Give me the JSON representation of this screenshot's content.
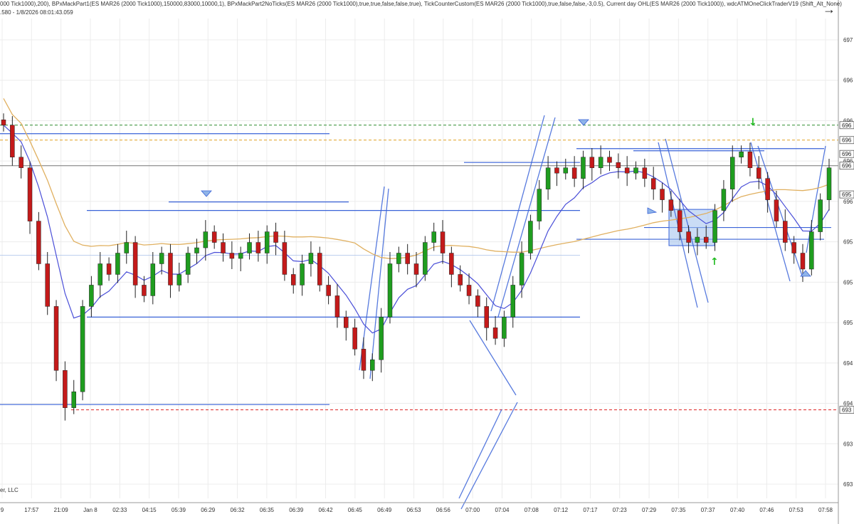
{
  "header": {
    "indicators_line": "000 Tick1000),200), BPxMackPart1(ES MAR26 (2000 Tick1000),150000,83000,10000,1), BPxMackPart2NoTicks(ES MAR26 (2000 Tick1000),true,true,false,false,true), TickCounterCustom(ES MAR26 (2000 Tick1000),true,false,false,-3,0.5), Current day OHL(ES MAR26 (2000 Tick1000)), wdcATMOneClickTraderV19 (Shift_Alt_None)",
    "status_line": ".580 - 1/8/2026 08:01:43.059",
    "nav_icon": "arrow-right-icon"
  },
  "copyright": "er, LLC",
  "colors": {
    "up_candle": "#1f9d1f",
    "down_candle": "#c41a1a",
    "ema_fast": "#4a4fd8",
    "sma_slow": "#e0b060",
    "trend_lines": "#3a63d8",
    "prior_high": "#2e8b2e",
    "day_open": "#e0a020",
    "day_low": "#dd2222",
    "signal_triangle": "#8fb4e8",
    "signal_arrow": "#22bb22",
    "zone_box": "#9ec0ec"
  },
  "chart_data": {
    "type": "candlestick",
    "instrument": "ES MAR26 (2000 Tick1000)",
    "x_tick_labels": [
      "9",
      "17:57",
      "21:09",
      "Jan 8",
      "02:33",
      "04:15",
      "05:39",
      "06:29",
      "06:32",
      "06:35",
      "06:39",
      "06:42",
      "06:45",
      "06:49",
      "06:53",
      "06:56",
      "07:00",
      "07:04",
      "07:08",
      "07:12",
      "07:17",
      "07:23",
      "07:29",
      "07:35",
      "07:37",
      "07:40",
      "07:46",
      "07:53",
      "07:58"
    ],
    "y_tick_labels": [
      "697",
      "696",
      "696",
      "696",
      "696",
      "695",
      "695",
      "695",
      "694",
      "694",
      "693",
      "693"
    ],
    "ylim": [
      6930,
      6975
    ],
    "levels": [
      {
        "name": "prior-high",
        "value": 6965.0,
        "style": "dashed"
      },
      {
        "name": "day-open",
        "value": 6963.6,
        "style": "dashed"
      },
      {
        "name": "day-low",
        "value": 6938.3,
        "style": "dashed"
      },
      {
        "name": "last-price",
        "value": 6961.2,
        "style": "solid"
      }
    ],
    "price_tags": [
      "696",
      "696",
      "696",
      "696",
      "695",
      "693"
    ],
    "close_series": [
      6965,
      6962,
      6961,
      6956,
      6952,
      6948,
      6942,
      6938.5,
      6940,
      6948,
      6950,
      6952,
      6951,
      6953,
      6954,
      6950,
      6949,
      6952,
      6953,
      6950,
      6951,
      6953,
      6953.5,
      6955,
      6954,
      6953,
      6952.5,
      6953,
      6954,
      6953,
      6955,
      6954,
      6951,
      6950,
      6952,
      6953,
      6950,
      6949,
      6947,
      6946,
      6944,
      6942,
      6943,
      6947,
      6952,
      6953,
      6952,
      6951,
      6954,
      6955,
      6953,
      6951,
      6950,
      6949,
      6948,
      6946,
      6945,
      6947,
      6950,
      6953,
      6956,
      6959,
      6961,
      6960.5,
      6961,
      6960,
      6962,
      6961,
      6962,
      6961.5,
      6961,
      6960.5,
      6961,
      6960,
      6959,
      6958,
      6957,
      6955,
      6954,
      6954.5,
      6954,
      6957,
      6959,
      6962,
      6962.5,
      6961,
      6960,
      6958,
      6956,
      6954,
      6953,
      6951.5,
      6955,
      6958,
      6961
    ]
  }
}
